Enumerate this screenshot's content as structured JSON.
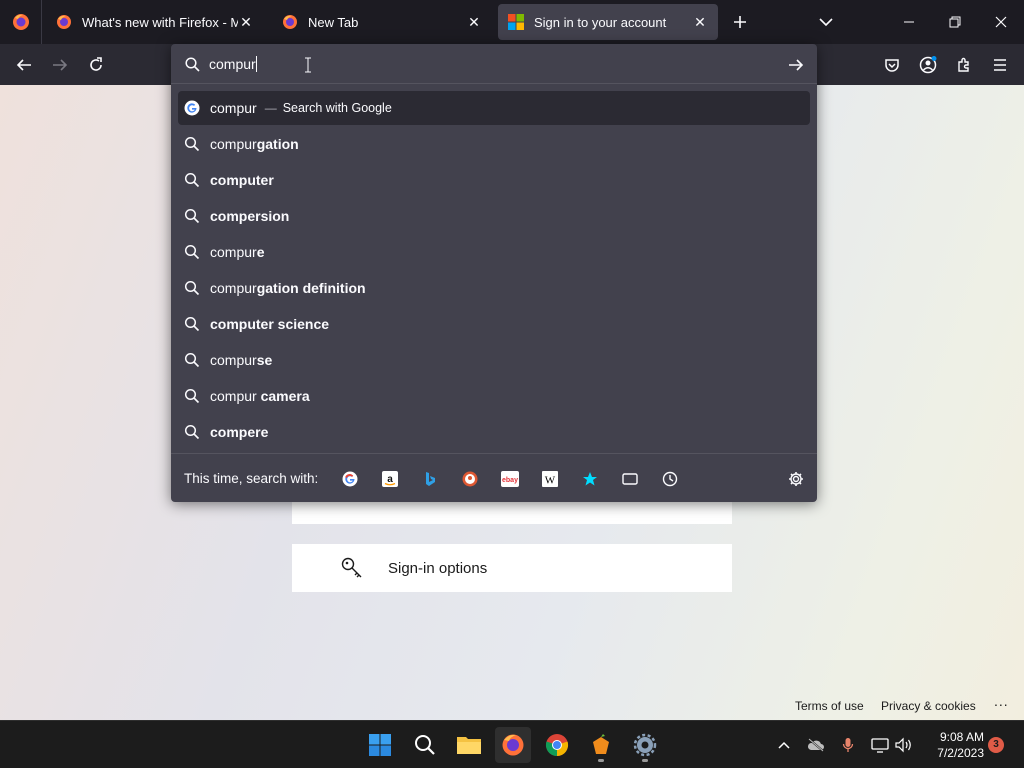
{
  "tabs": [
    {
      "title": "What's new with Firefox - More",
      "favicon": "firefox-icon"
    },
    {
      "title": "New Tab",
      "favicon": "firefox-icon"
    },
    {
      "title": "Sign in to your account",
      "favicon": "microsoft-icon",
      "active": true
    }
  ],
  "urlbar": {
    "value": "compur"
  },
  "suggestions": [
    {
      "prefix": "compur",
      "bold": "",
      "type": "search-engine",
      "sep": "—",
      "action": "Search with Google"
    },
    {
      "prefix": "compur",
      "bold": "gation"
    },
    {
      "prefix": "",
      "bold": "computer"
    },
    {
      "prefix": "",
      "bold": "compersion"
    },
    {
      "prefix": "compur",
      "bold": "e"
    },
    {
      "prefix": "compur",
      "bold": "gation definition"
    },
    {
      "prefix": "",
      "bold": "computer science"
    },
    {
      "prefix": "compur",
      "bold": "se"
    },
    {
      "prefix": "compur ",
      "bold": "camera"
    },
    {
      "prefix": "",
      "bold": "compere"
    }
  ],
  "oneoff": {
    "label": "This time, search with:",
    "engines": [
      "google-icon",
      "amazon-icon",
      "bing-icon",
      "duckduckgo-icon",
      "ebay-icon",
      "wikipedia-icon",
      "bookmarks-icon",
      "tabs-icon",
      "history-icon"
    ]
  },
  "page": {
    "signin_options": "Sign-in options",
    "footer": {
      "terms": "Terms of use",
      "privacy": "Privacy & cookies",
      "more": "..."
    }
  },
  "taskbar": {
    "time": "9:08 AM",
    "date": "7/2/2023",
    "notifications": "3"
  },
  "colors": {
    "accent": "#0078d4",
    "popup_bg": "#42414d",
    "toolbar_bg": "#2b2a33",
    "tabstrip_bg": "#1c1b22"
  }
}
